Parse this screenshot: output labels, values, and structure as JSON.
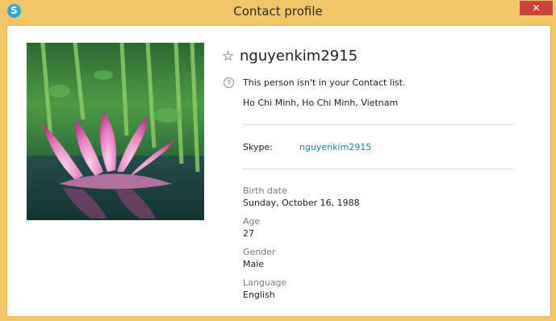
{
  "window": {
    "title": "Contact profile",
    "app_icon": "S",
    "close_label": "✕"
  },
  "profile": {
    "name": "nguyenkim2915",
    "contact_notice": "This person isn't in your Contact list.",
    "location": "Ho Chi Minh, Ho Chi Minh, Vietnam",
    "skype_label": "Skype:",
    "skype_value": "nguyenkim2915"
  },
  "details": {
    "birth_date_label": "Birth date",
    "birth_date_value": "Sunday, October 16, 1988",
    "age_label": "Age",
    "age_value": "27",
    "gender_label": "Gender",
    "gender_value": "Male",
    "language_label": "Language",
    "language_value": "English"
  },
  "colors": {
    "frame": "#f1c666",
    "close_button": "#c8443b",
    "link": "#1f7fb0",
    "skype_blue": "#2aa7df"
  },
  "icons": [
    "skype-icon",
    "close-icon",
    "favorite-star-icon",
    "info-icon"
  ]
}
